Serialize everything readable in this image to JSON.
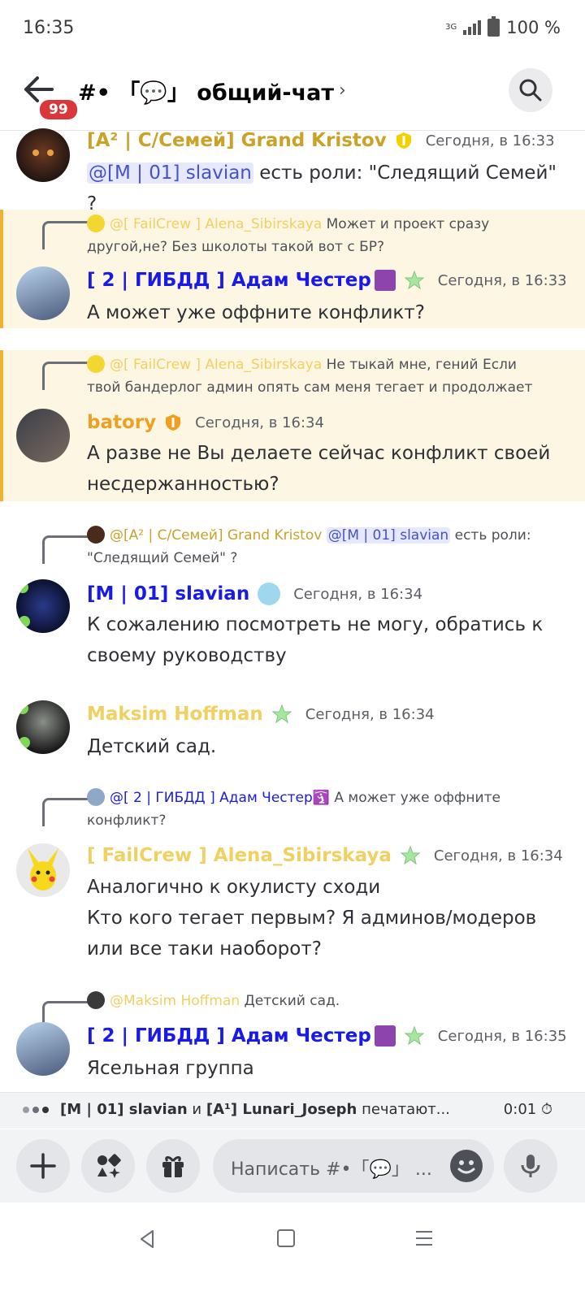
{
  "status": {
    "time": "16:35",
    "network": "3G",
    "battery": "100 %"
  },
  "header": {
    "unread_badge": "99",
    "channel_name": "#• 「💬」 общий-чат",
    "chevron": "›"
  },
  "messages": [
    {
      "author": "[A² | С/Семей] Grand Kristov",
      "color": "#c9a227",
      "time": "Сегодня, в 16:33",
      "mention": "@[M | 01] slavian",
      "text": " есть роли: \"Следящий Семей\" ?"
    },
    {
      "reply_author": "@[ FailCrew ] Alena_Sibirskaya",
      "reply_text": " Может и проект сразу другой,не? Без школоты такой вот с БР?",
      "author": "[ 2 | ГИБДД ] Адам Честер",
      "color": "#1a1ae6",
      "time": "Сегодня, в 16:33",
      "text": "А может уже оффните конфликт?"
    },
    {
      "reply_author": "@[ FailCrew ] Alena_Sibirskaya",
      "reply_text": " Не тыкай мне, гений  Если твой бандерлог админ опять сам меня тегает и продолжает",
      "author": "batory",
      "color": "#f0a020",
      "time": "Сегодня, в 16:34",
      "text": "А разве не Вы делаете сейчас конфликт своей несдержанностью?"
    },
    {
      "reply_author": "@[A² | С/Семей] Grand Kristov",
      "reply_mention": "@[M | 01] slavian",
      "reply_text": " есть роли: \"Следящий Семей\" ?",
      "author": "[M | 01] slavian",
      "color": "#1a1ae6",
      "time": "Сегодня, в 16:34",
      "text": "К сожалению посмотреть не могу, обратись к своему руководству"
    },
    {
      "author": "Maksim Hoffman",
      "color": "#f0d060",
      "time": "Сегодня, в 16:34",
      "text": "Детский сад."
    },
    {
      "reply_author": "@[ 2 | ГИБДД ] Адам Честер🛐",
      "reply_text": " А может уже оффните конфликт?",
      "author": "[ FailCrew ] Alena_Sibirskaya",
      "color": "#f0d060",
      "time": "Сегодня, в 16:34",
      "text_lines": [
        "Аналогично к окулисту сходи",
        "Кто кого тегает первым? Я админов/модеров",
        "или все таки наоборот?"
      ]
    },
    {
      "reply_author": "@Maksim Hoffman",
      "reply_text": " Детский сад.",
      "author": "[ 2 | ГИБДД ] Адам Честер",
      "color": "#1a1ae6",
      "time": "Сегодня, в 16:35",
      "text": "Ясельная группа"
    }
  ],
  "typing": {
    "users_a": "[M | 01] slavian",
    "connector": " и ",
    "users_b": "[A¹] Lunari_Joseph",
    "suffix": " печатают...",
    "timer": "0:01"
  },
  "composer": {
    "placeholder": "Написать #•「💬」 ..."
  }
}
